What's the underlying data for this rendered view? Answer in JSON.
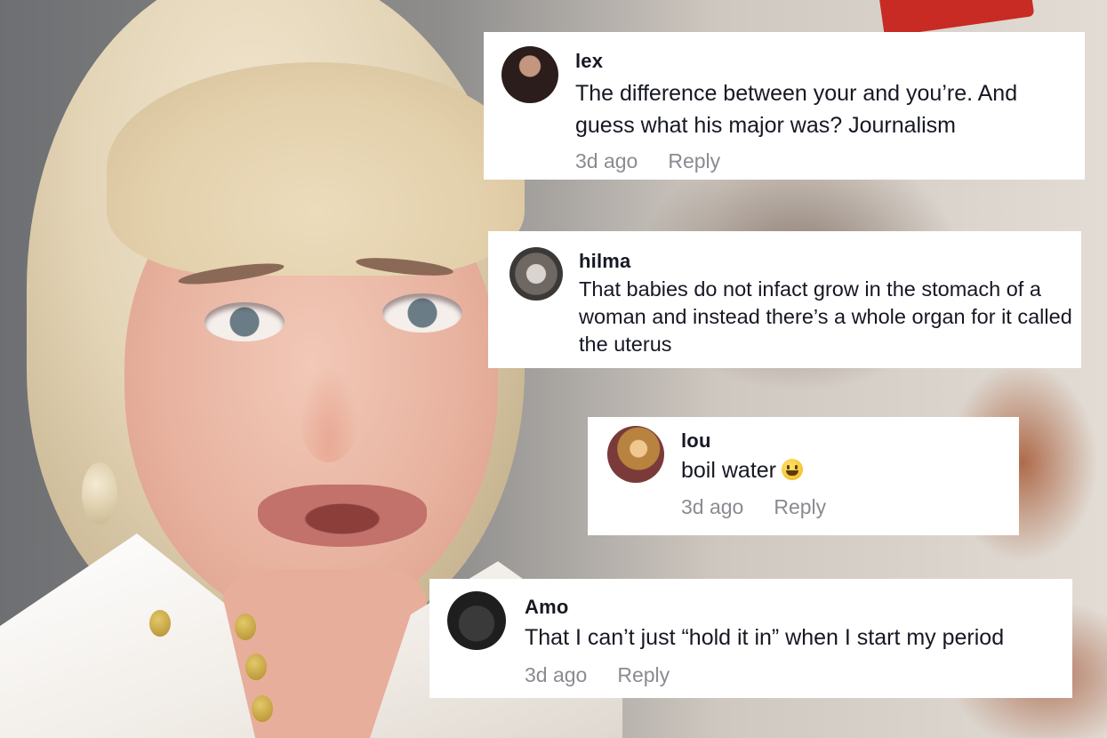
{
  "comments": [
    {
      "username": "lex",
      "text": "The difference between your and you’re. And guess what his major was? Journalism",
      "time": "3d ago",
      "reply_label": "Reply"
    },
    {
      "username": "hilma",
      "text": "That babies do not infact grow in the stomach of a woman and instead there’s a whole organ for it called the uterus"
    },
    {
      "username": "lou",
      "text": "boil water",
      "emoji_icon": "grinning-face-emoji",
      "time": "3d ago",
      "reply_label": "Reply"
    },
    {
      "username": "Amo",
      "text": "That I can’t just “hold it in” when I start my period",
      "time": "3d ago",
      "reply_label": "Reply"
    }
  ],
  "colors": {
    "card_bg": "#ffffff",
    "username": "#161823",
    "comment_text": "#161823",
    "meta_text": "#8a8b91"
  }
}
